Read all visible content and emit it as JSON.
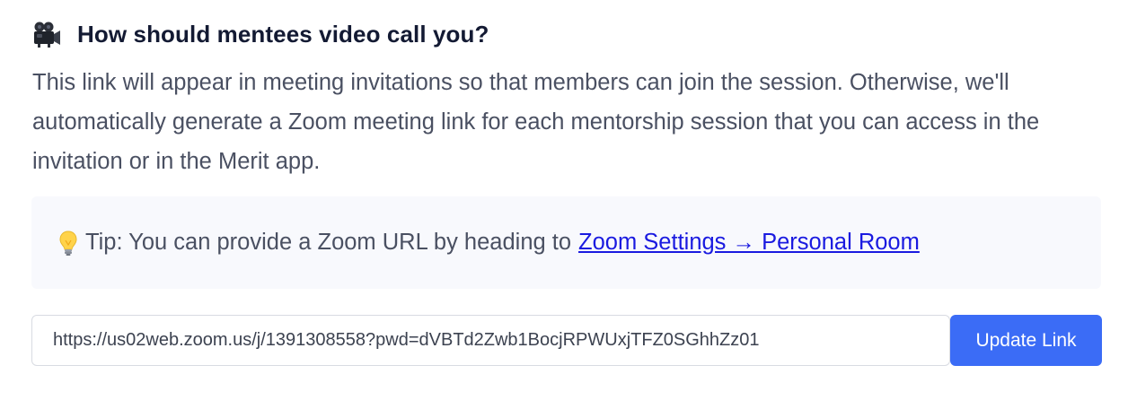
{
  "section": {
    "icon": "movie-camera-icon",
    "heading": "How should mentees video call you?",
    "description": "This link will appear in meeting invitations so that members can join the session. Otherwise, we'll automatically generate a Zoom meeting link for each mentorship session that you can access in the invitation or in the Merit app."
  },
  "tip": {
    "icon": "light-bulb-icon",
    "text": "Tip: You can provide a Zoom URL by heading to",
    "link_label": "Zoom Settings → Personal Room"
  },
  "form": {
    "url_value": "https://us02web.zoom.us/j/1391308558?pwd=dVBTd2Zwb1BocjRPWUxjTFZ0SGhhZz01",
    "button_label": "Update Link"
  },
  "colors": {
    "accent": "#3b6cf6",
    "link": "#1a1ae0",
    "tip_background": "#f8f9fd"
  }
}
